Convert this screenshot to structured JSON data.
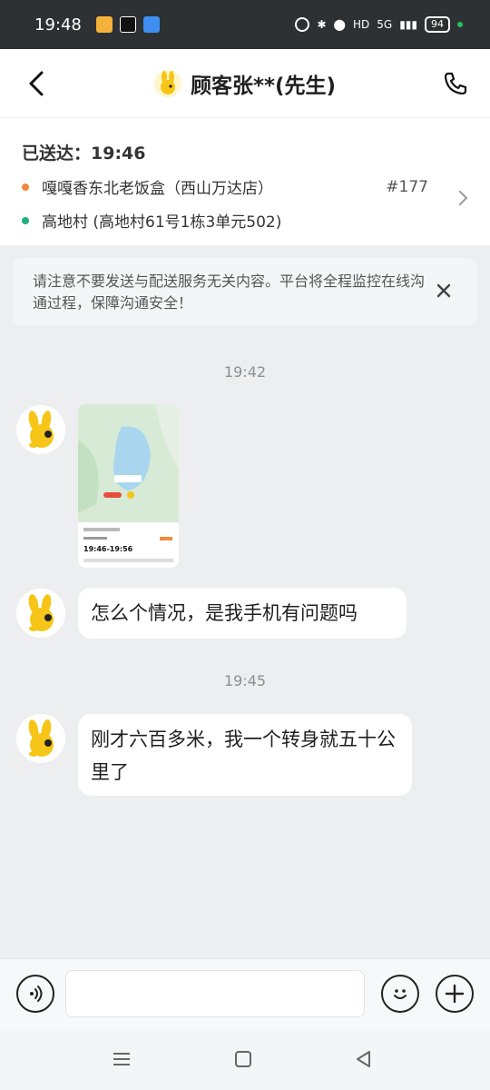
{
  "status_bar": {
    "time": "19:48",
    "battery": "94",
    "network": "5G",
    "hd": "HD",
    "apps": [
      "weather-app-icon",
      "tiktok-app-icon",
      "messages-app-icon"
    ]
  },
  "header": {
    "title": "顾客张**(先生)"
  },
  "order": {
    "delivered_label": "已送达：19:46",
    "store": "嘎嘎香东北老饭盒（西山万达店）",
    "order_number": "#177",
    "address": "高地村 (高地村61号1栋3单元502)"
  },
  "notice": {
    "text": "请注意不要发送与配送服务无关内容。平台将全程监控在线沟通过程，保障沟通安全！"
  },
  "chat": {
    "messages": [
      {
        "timestamp": "19:42"
      },
      {
        "type": "image",
        "content": "map-screenshot"
      },
      {
        "type": "text",
        "content": "怎么个情况，是我手机有问题吗"
      },
      {
        "timestamp": "19:45"
      },
      {
        "type": "text",
        "content": "刚才六百多米，我一个转身就五十公里了"
      }
    ]
  },
  "map_preview": {
    "time_range": "19:46-19:56"
  },
  "input": {
    "placeholder": ""
  },
  "colors": {
    "status_bar_bg": "#2d3134",
    "store_dot": "#f08a3c",
    "address_dot": "#22b07d",
    "mascot": "#f7c518"
  }
}
